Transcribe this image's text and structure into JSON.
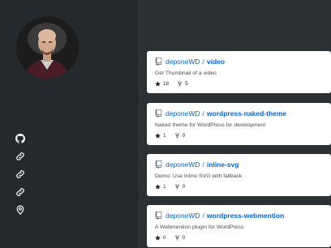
{
  "sidebar": {
    "social_icons": [
      "github-icon",
      "link-icon",
      "link-icon",
      "link-icon",
      "location-pin-icon"
    ]
  },
  "repos": [
    {
      "owner": "deponeWD",
      "separator": "/",
      "name": "video",
      "description": "Get Thumbnail of a video",
      "stars": "18",
      "forks": "5"
    },
    {
      "owner": "deponeWD",
      "separator": "/",
      "name": "wordpress-naked-theme",
      "description": "Naked theme for WordPress for development",
      "stars": "1",
      "forks": "0"
    },
    {
      "owner": "deponeWD",
      "separator": "/",
      "name": "inline-svg",
      "description": "Demo: Use Inline SVG with fallback",
      "stars": "1",
      "forks": "0"
    },
    {
      "owner": "deponeWD",
      "separator": "/",
      "name": "wordpress-webmention",
      "description": "A Webmention plugin for WordPress",
      "stars": "0",
      "forks": "0"
    }
  ],
  "colors": {
    "sidebar_bg": "#24292e",
    "main_bg": "#2b3035",
    "link": "#0366d6",
    "card_bg": "#ffffff"
  }
}
